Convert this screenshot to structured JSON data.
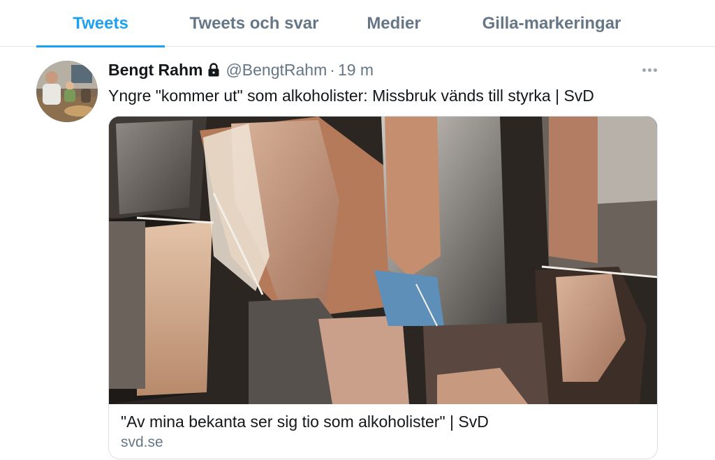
{
  "tabs": [
    {
      "label": "Tweets",
      "active": true
    },
    {
      "label": "Tweets och svar",
      "active": false
    },
    {
      "label": "Medier",
      "active": false
    },
    {
      "label": "Gilla-markeringar",
      "active": false
    }
  ],
  "tweet": {
    "display_name": "Bengt Rahm",
    "protected_icon": "lock-icon",
    "handle": "@BengtRahm",
    "separator": "·",
    "time": "19 m",
    "text": "Yngre \"kommer ut\" som alkoholister: Missbruk vänds till styrka | SvD",
    "card": {
      "title": "\"Av mina bekanta ser sig tio som alkoholister\" | SvD",
      "domain": "svd.se",
      "image_icon": "collage-image"
    }
  },
  "colors": {
    "accent": "#1da1f2",
    "secondary_text": "#657786",
    "primary_text": "#14171a",
    "border": "#e1e8ed"
  }
}
